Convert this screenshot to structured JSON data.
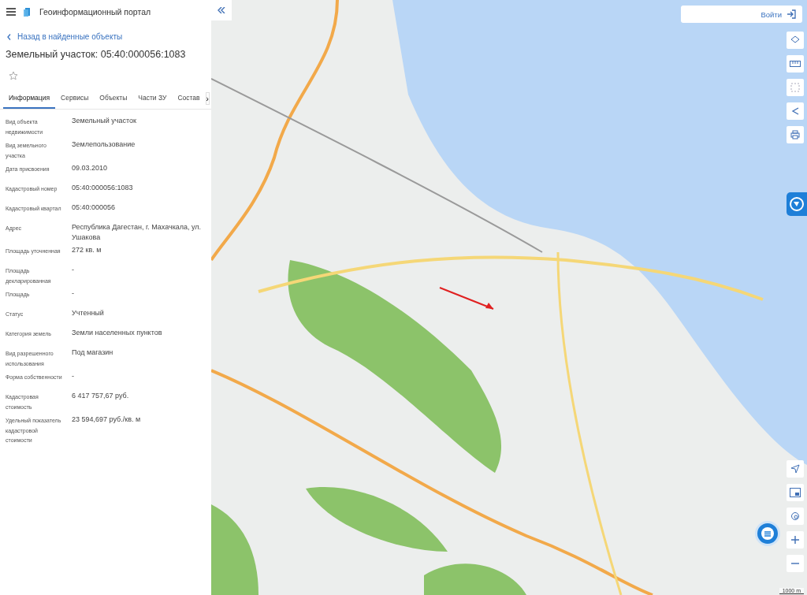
{
  "header": {
    "title": "Геоинформационный портал"
  },
  "back_link": "Назад в найденные объекты",
  "object_title": "Земельный участок: 05:40:000056:1083",
  "favorite": {
    "selected": false
  },
  "tabs": [
    {
      "label": "Информация",
      "selected": true
    },
    {
      "label": "Сервисы",
      "selected": false
    },
    {
      "label": "Объекты",
      "selected": false
    },
    {
      "label": "Части ЗУ",
      "selected": false
    },
    {
      "label": "Состав",
      "selected": false
    }
  ],
  "tabs_scroll": "›",
  "properties": [
    {
      "label": "Вид объекта недвижимости",
      "value": "Земельный участок"
    },
    {
      "label": "Вид земельного участка",
      "value": "Землепользование"
    },
    {
      "label": "Дата присвоения",
      "value": "09.03.2010"
    },
    {
      "label": "Кадастровый номер",
      "value": "05:40:000056:1083"
    },
    {
      "label": "Кадастровый квартал",
      "value": "05:40:000056"
    },
    {
      "label": "Адрес",
      "value": "Республика Дагестан, г. Махачкала, ул. Ушакова"
    },
    {
      "label": "Площадь уточненная",
      "value": "272 кв. м"
    },
    {
      "label": "Площадь декларированная",
      "value": "-"
    },
    {
      "label": "Площадь",
      "value": "-"
    },
    {
      "label": "Статус",
      "value": "Учтенный"
    },
    {
      "label": "Категория земель",
      "value": "Земли населенных пунктов"
    },
    {
      "label": "Вид разрешенного использования",
      "value": "Под магазин"
    },
    {
      "label": "Форма собственности",
      "value": "-"
    },
    {
      "label": "Кадастровая стоимость",
      "value": "6 417 757,67 руб."
    },
    {
      "label": "Удельный показатель кадастровой стоимости",
      "value": "23 594,697 руб./кв. м"
    }
  ],
  "map": {
    "login_button": "Войти",
    "scale": "1000 m"
  }
}
